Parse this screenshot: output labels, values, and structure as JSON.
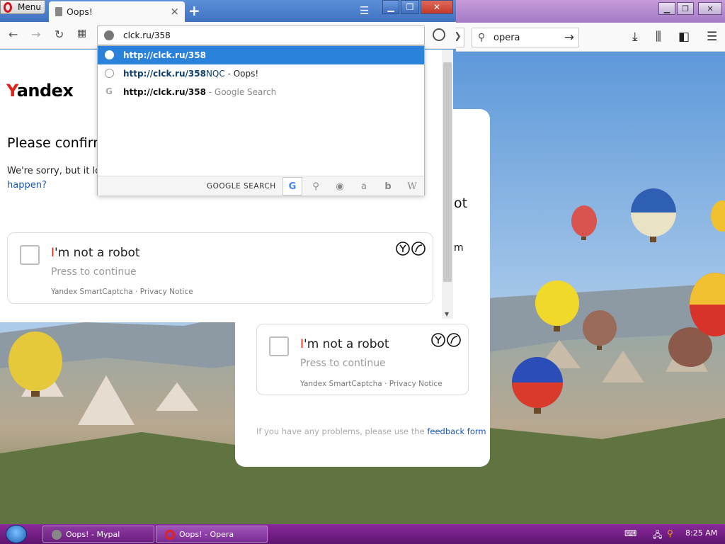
{
  "main_window": {
    "menu_label": "Menu",
    "tab_title": "Oops!",
    "tab_close": "×",
    "new_tab": "+",
    "url_value": "clck.ru/358"
  },
  "dropdown": {
    "suggestions": [
      {
        "url": "http://clck.ru/358",
        "rest": "",
        "extra": ""
      },
      {
        "url": "http://clck.ru/358",
        "rest": "NQC",
        "extra": " - Oops!"
      },
      {
        "url": "http://clck.ru/358",
        "rest": "",
        "extra": " - Google Search"
      }
    ],
    "google_search_label": "GOOGLE SEARCH"
  },
  "page": {
    "logo_red": "Y",
    "logo_rest": "andex",
    "confirm_heading": "Please confirm",
    "sorry_text": "We're sorry, but it loo",
    "happen_text": "happen?"
  },
  "captcha": {
    "title_red": "I",
    "title_rest": "'m not a robot",
    "subtitle": "Press to continue",
    "footer": "Yandex SmartCaptcha · Privacy Notice",
    "footer_left": "Yandex SmartCaptcha",
    "footer_sep": "·",
    "footer_right": "Privacy Notice",
    "feedback_prefix": "If you have any problems, please use the",
    "feedback_link": "feedback form",
    "heading_fragment": "ot",
    "body_fragment": "m"
  },
  "background_window": {
    "search_value": "opera"
  },
  "taskbar": {
    "tasks": [
      {
        "label": "Oops! - Mypal"
      },
      {
        "label": "Oops! - Opera"
      }
    ],
    "clock": "8:25 AM"
  },
  "colors": {
    "selected_row": "#2a82da",
    "yandex_red": "#e0231b",
    "link_blue": "#1a56b6",
    "taskbar": "#7a2090"
  }
}
